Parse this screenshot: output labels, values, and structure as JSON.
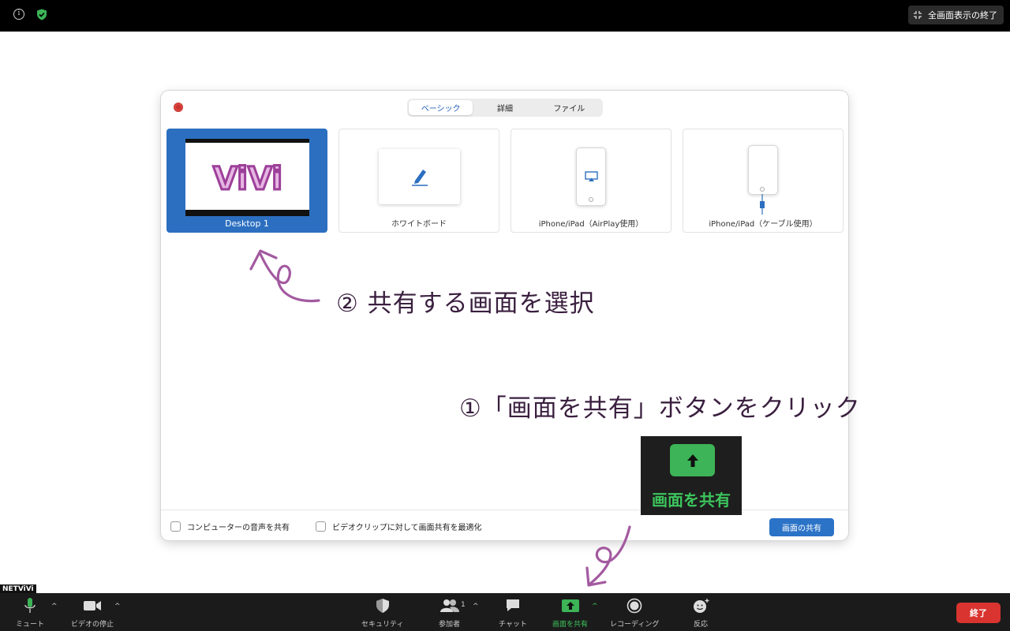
{
  "topbar": {
    "exit_fullscreen_label": "全画面表示の終了",
    "info_icon": "info-icon",
    "security_icon": "shield-check-icon"
  },
  "dialog": {
    "tabs": [
      {
        "label": "ベーシック",
        "active": true
      },
      {
        "label": "詳細",
        "active": false
      },
      {
        "label": "ファイル",
        "active": false
      }
    ],
    "cards": [
      {
        "label": "Desktop 1",
        "selected": true
      },
      {
        "label": "ホワイトボード",
        "selected": false
      },
      {
        "label": "iPhone/iPad（AirPlay使用）",
        "selected": false
      },
      {
        "label": "iPhone/iPad（ケーブル使用）",
        "selected": false
      }
    ],
    "desktop_preview_logo": "ViVi",
    "footer": {
      "share_audio_label": "コンピューターの音声を共有",
      "optimize_video_label": "ビデオクリップに対して画面共有を最適化",
      "share_button_label": "画面の共有"
    }
  },
  "annotations": {
    "step2": "② 共有する画面を選択",
    "step1": "①「画面を共有」ボタンをクリック",
    "highlight_label": "画面を共有"
  },
  "watermark": "NETViVi",
  "toolbar": {
    "items": [
      {
        "label": "ミュート",
        "icon": "microphone-icon"
      },
      {
        "label": "ビデオの停止",
        "icon": "video-camera-icon"
      },
      {
        "label": "セキュリティ",
        "icon": "shield-icon"
      },
      {
        "label": "参加者",
        "icon": "participants-icon",
        "count": "1"
      },
      {
        "label": "チャット",
        "icon": "chat-icon"
      },
      {
        "label": "画面を共有",
        "icon": "share-screen-icon"
      },
      {
        "label": "レコーディング",
        "icon": "record-icon"
      },
      {
        "label": "反応",
        "icon": "reaction-icon"
      }
    ],
    "end_label": "終了"
  },
  "colors": {
    "selected_card": "#2c6fc0",
    "share_green": "#3cb457",
    "end_red": "#d9342f",
    "annotation_arrow": "#a35aa0"
  }
}
